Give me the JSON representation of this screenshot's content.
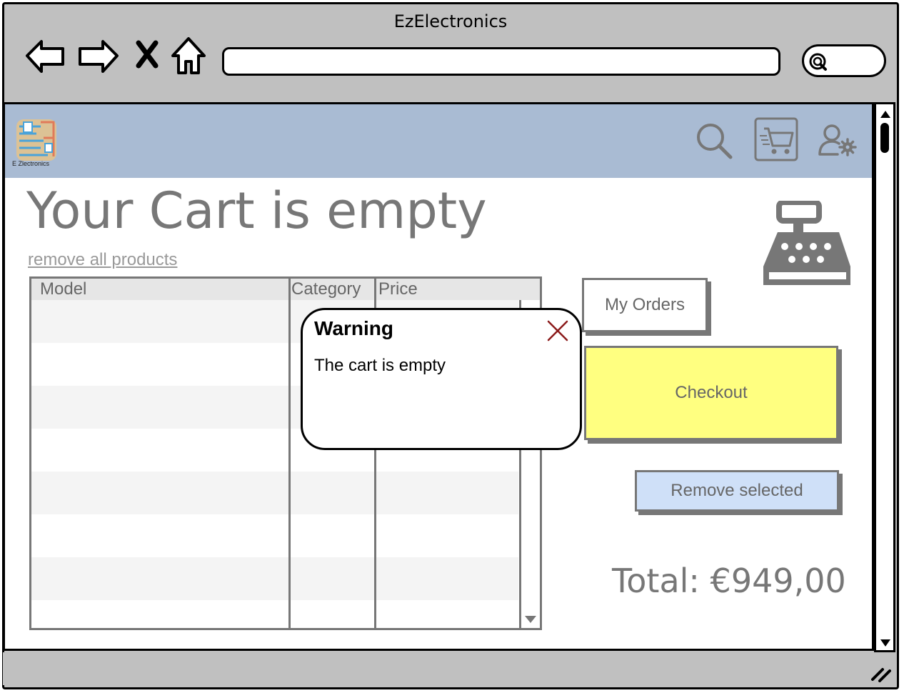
{
  "browser": {
    "title": "EzElectronics",
    "url": "",
    "search": ""
  },
  "header": {
    "logo_text": "E Zlectronics"
  },
  "main": {
    "title": "Your Cart is empty",
    "remove_all_link": "remove all products"
  },
  "table": {
    "columns": [
      "Model",
      "Category",
      "Price"
    ],
    "rows": []
  },
  "buttons": {
    "orders": "My Orders",
    "checkout": "Checkout",
    "remove_selected": "Remove selected"
  },
  "total": "Total: €949,00",
  "dialog": {
    "title": "Warning",
    "message": "The cart is empty"
  },
  "colors": {
    "header_bg": "#a9bbd3",
    "checkout_bg": "#ffff80",
    "remove_bg": "#cfe0f8",
    "close_icon": "#8b1a1a"
  }
}
